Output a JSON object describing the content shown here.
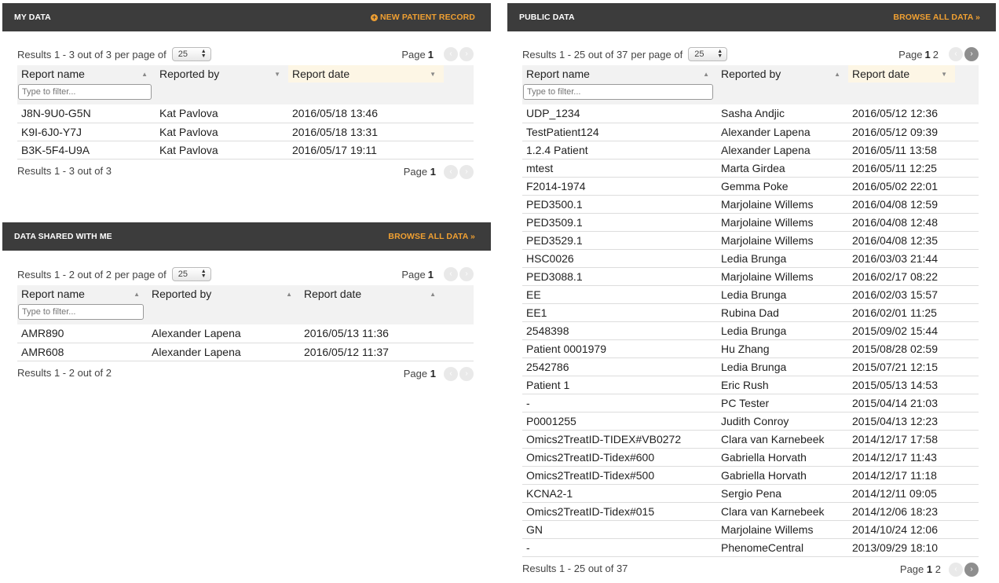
{
  "my_data": {
    "title": "MY DATA",
    "action": "NEW PATIENT RECORD",
    "results_text": "Results 1 - 3 out of 3",
    "per_page_label": "per page of",
    "per_page_value": "25",
    "page_label": "Page",
    "pages": [
      "1"
    ],
    "columns": [
      "Report name",
      "Reported by",
      "Report date"
    ],
    "filter_placeholder": "Type to filter...",
    "rows": [
      [
        "J8N-9U0-G5N",
        "Kat Pavlova",
        "2016/05/18 13:46"
      ],
      [
        "K9I-6J0-Y7J",
        "Kat Pavlova",
        "2016/05/18 13:31"
      ],
      [
        "B3K-5F4-U9A",
        "Kat Pavlova",
        "2016/05/17 19:11"
      ]
    ],
    "footer_results": "Results 1 - 3 out of 3"
  },
  "shared_data": {
    "title": "DATA SHARED WITH ME",
    "action": "BROWSE ALL DATA »",
    "results_text": "Results 1 - 2 out of 2",
    "per_page_label": "per page of",
    "per_page_value": "25",
    "page_label": "Page",
    "pages": [
      "1"
    ],
    "columns": [
      "Report name",
      "Reported by",
      "Report date"
    ],
    "filter_placeholder": "Type to filter...",
    "rows": [
      [
        "AMR890",
        "Alexander Lapena",
        "2016/05/13 11:36"
      ],
      [
        "AMR608",
        "Alexander Lapena",
        "2016/05/12 11:37"
      ]
    ],
    "footer_results": "Results 1 - 2 out of 2"
  },
  "public_data": {
    "title": "PUBLIC DATA",
    "action": "BROWSE ALL DATA »",
    "results_text": "Results 1 - 25 out of 37",
    "per_page_label": "per page of",
    "per_page_value": "25",
    "page_label": "Page",
    "pages": [
      "1",
      "2"
    ],
    "columns": [
      "Report name",
      "Reported by",
      "Report date"
    ],
    "filter_placeholder": "Type to filter...",
    "rows": [
      [
        "UDP_1234",
        "Sasha Andjic",
        "2016/05/12 12:36"
      ],
      [
        "TestPatient124",
        "Alexander Lapena",
        "2016/05/12 09:39"
      ],
      [
        "1.2.4 Patient",
        "Alexander Lapena",
        "2016/05/11 13:58"
      ],
      [
        "mtest",
        "Marta Girdea",
        "2016/05/11 12:25"
      ],
      [
        "F2014-1974",
        "Gemma Poke",
        "2016/05/02 22:01"
      ],
      [
        "PED3500.1",
        "Marjolaine Willems",
        "2016/04/08 12:59"
      ],
      [
        "PED3509.1",
        "Marjolaine Willems",
        "2016/04/08 12:48"
      ],
      [
        "PED3529.1",
        "Marjolaine Willems",
        "2016/04/08 12:35"
      ],
      [
        "HSC0026",
        "Ledia Brunga",
        "2016/03/03 21:44"
      ],
      [
        "PED3088.1",
        "Marjolaine Willems",
        "2016/02/17 08:22"
      ],
      [
        "EE",
        "Ledia Brunga",
        "2016/02/03 15:57"
      ],
      [
        "EE1",
        "Rubina Dad",
        "2016/02/01 11:25"
      ],
      [
        "2548398",
        "Ledia Brunga",
        "2015/09/02 15:44"
      ],
      [
        "Patient 0001979",
        "Hu Zhang",
        "2015/08/28 02:59"
      ],
      [
        "2542786",
        "Ledia Brunga",
        "2015/07/21 12:15"
      ],
      [
        "Patient 1",
        "Eric Rush",
        "2015/05/13 14:53"
      ],
      [
        "-",
        "PC Tester",
        "2015/04/14 21:03"
      ],
      [
        "P0001255",
        "Judith Conroy",
        "2015/04/13 12:23"
      ],
      [
        "Omics2TreatID-TIDEX#VB0272",
        "Clara van Karnebeek",
        "2014/12/17 17:58"
      ],
      [
        "Omics2TreatID-Tidex#600",
        "Gabriella Horvath",
        "2014/12/17 11:43"
      ],
      [
        "Omics2TreatID-Tidex#500",
        "Gabriella Horvath",
        "2014/12/17 11:18"
      ],
      [
        "KCNA2-1",
        "Sergio Pena",
        "2014/12/11 09:05"
      ],
      [
        "Omics2TreatID-Tidex#015",
        "Clara van Karnebeek",
        "2014/12/06 18:23"
      ],
      [
        "GN",
        "Marjolaine Willems",
        "2014/10/24 12:06"
      ],
      [
        "-",
        "PhenomeCentral",
        "2013/09/29 18:10"
      ]
    ],
    "footer_results": "Results 1 - 25 out of 37"
  }
}
